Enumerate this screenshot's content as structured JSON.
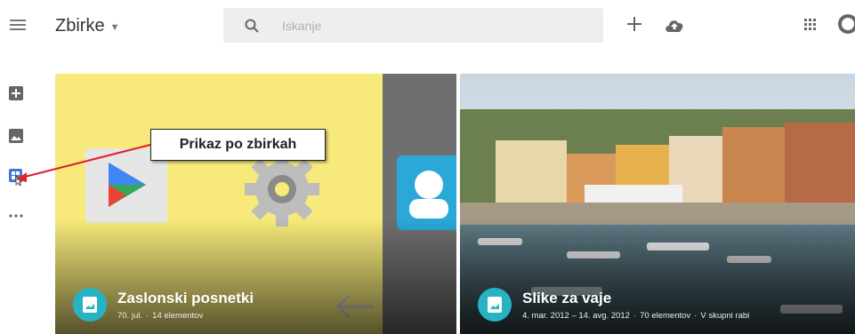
{
  "header": {
    "title": "Zbirke",
    "search_placeholder": "Iskanje"
  },
  "left_rail": {
    "items": [
      {
        "icon": "add-photo-icon"
      },
      {
        "icon": "photos-icon"
      },
      {
        "icon": "collections-icon"
      },
      {
        "icon": "more-icon"
      }
    ]
  },
  "annotation": {
    "text": "Prikaz po zbirkah",
    "color": "#e0202a"
  },
  "collections": [
    {
      "title": "Zaslonski posnetki",
      "meta": [
        "70. jul.",
        "·",
        "14 elementov"
      ],
      "badge_color": "#26b4c4"
    },
    {
      "title": "Slike za vaje",
      "meta": [
        "4. mar. 2012 – 14. avg. 2012",
        "·",
        "70 elementov",
        "·",
        "V skupni rabi"
      ],
      "badge_color": "#26b4c4"
    }
  ],
  "colors": {
    "accent": "#26b4c4",
    "screenshots_bg": "#f7ea7b"
  }
}
